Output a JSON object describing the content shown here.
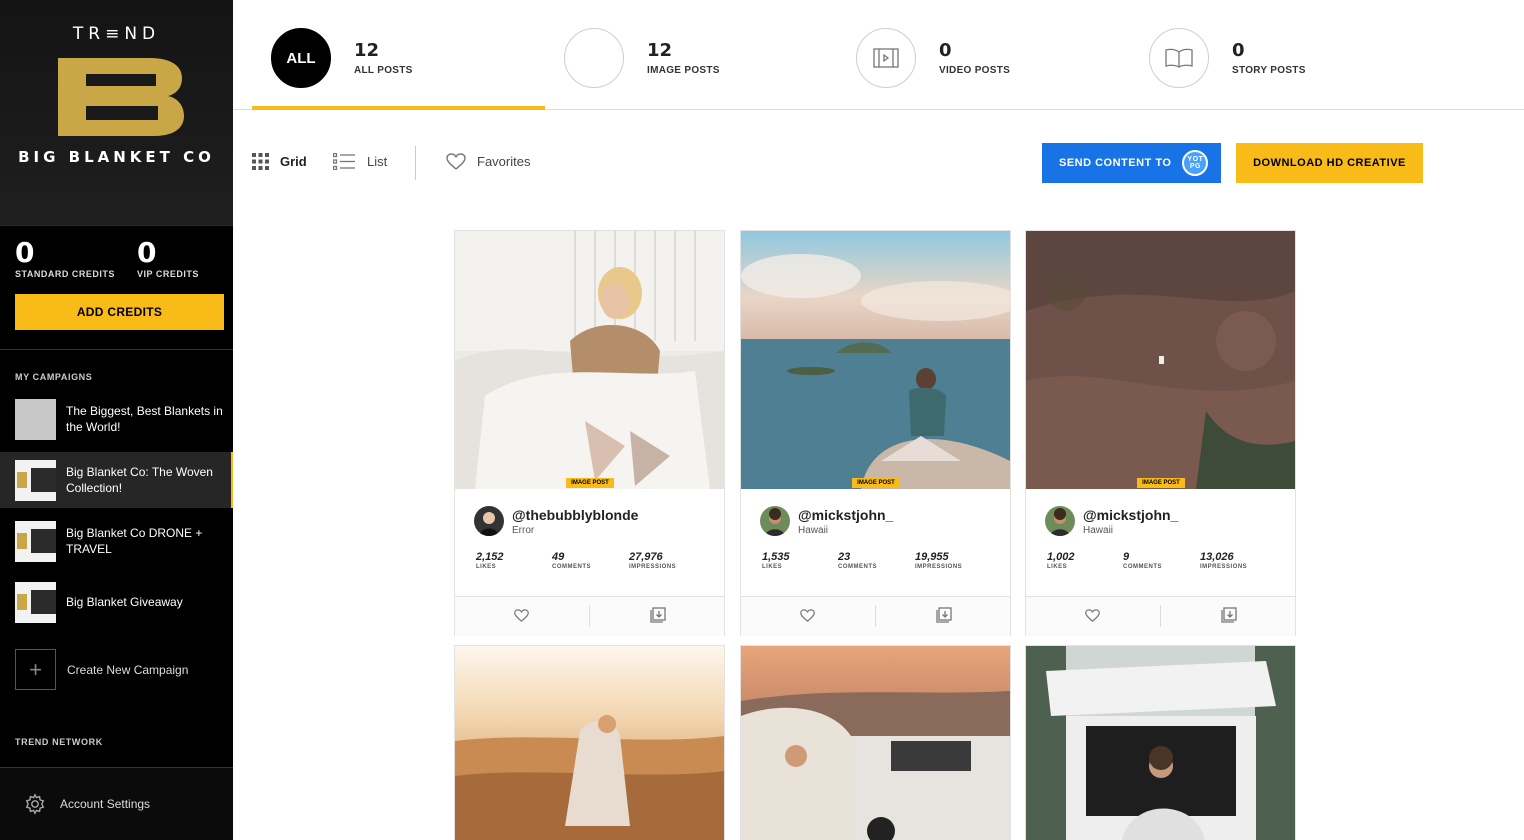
{
  "brand": {
    "top_text": "TR≡ND",
    "name": "BIG BLANKET CO",
    "colors": {
      "gold": "#c9a646",
      "accent": "#f8bb17",
      "blue": "#1874e6"
    }
  },
  "credits": {
    "standard": {
      "value": "0",
      "label": "STANDARD CREDITS"
    },
    "vip": {
      "value": "0",
      "label": "VIP CREDITS"
    },
    "add_button": "ADD CREDITS"
  },
  "sidebar": {
    "campaigns_title": "MY CAMPAIGNS",
    "campaigns": [
      {
        "label": "The Biggest, Best Blankets in the World!"
      },
      {
        "label": "Big Blanket Co: The Woven Collection!"
      },
      {
        "label": "Big Blanket Co DRONE + TRAVEL"
      },
      {
        "label": "Big Blanket Giveaway"
      }
    ],
    "create_new": "Create New Campaign",
    "network_title": "TREND NETWORK",
    "account_settings": "Account Settings"
  },
  "tabs": [
    {
      "circle": "ALL",
      "count": "12",
      "label": "ALL POSTS",
      "icon": "all"
    },
    {
      "circle": "",
      "count": "12",
      "label": "IMAGE POSTS",
      "icon": "image-icon"
    },
    {
      "circle": "",
      "count": "0",
      "label": "VIDEO POSTS",
      "icon": "film-icon"
    },
    {
      "circle": "",
      "count": "0",
      "label": "STORY POSTS",
      "icon": "book-icon"
    }
  ],
  "toolbar": {
    "grid": "Grid",
    "list": "List",
    "favorites": "Favorites",
    "send_content": "SEND CONTENT TO",
    "send_badge": "YOT PG",
    "download": "DOWNLOAD HD CREATIVE"
  },
  "cards": [
    {
      "badge": "IMAGE POST",
      "handle": "@thebubblyblonde",
      "location": "Error",
      "likes": "2,152",
      "comments": "49",
      "impressions": "27,976"
    },
    {
      "badge": "IMAGE POST",
      "handle": "@mickstjohn_",
      "location": "Hawaii",
      "likes": "1,535",
      "comments": "23",
      "impressions": "19,955"
    },
    {
      "badge": "IMAGE POST",
      "handle": "@mickstjohn_",
      "location": "Hawaii",
      "likes": "1,002",
      "comments": "9",
      "impressions": "13,026"
    }
  ],
  "stat_labels": {
    "likes": "LIKES",
    "comments": "COMMENTS",
    "impressions": "IMPRESSIONS"
  }
}
